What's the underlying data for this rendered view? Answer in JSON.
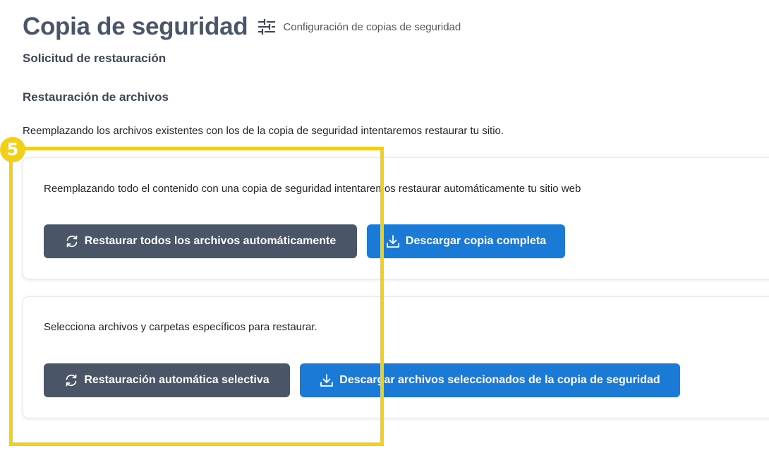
{
  "header": {
    "title": "Copia de seguridad",
    "settings_icon": "sliders-icon",
    "settings_label": "Configuración de copias de seguridad"
  },
  "subtitle": "Solicitud de restauración",
  "section": {
    "heading": "Restauración de archivos",
    "intro": "Reemplazando los archivos existentes con los de la copia de seguridad intentaremos restaurar tu sitio."
  },
  "cards": [
    {
      "description": "Reemplazando todo el contenido con una copia de seguridad intentaremos restaurar automáticamente tu sitio web",
      "primary_button": {
        "label": "Restaurar todos los archivos automáticamente",
        "icon": "refresh-icon"
      },
      "secondary_button": {
        "label": "Descargar copia completa",
        "icon": "download-icon"
      }
    },
    {
      "description": "Selecciona archivos y carpetas específicos para restaurar.",
      "primary_button": {
        "label": "Restauración automática selectiva",
        "icon": "refresh-icon"
      },
      "secondary_button": {
        "label": "Descargar archivos seleccionados de la copia de seguridad",
        "icon": "download-icon"
      }
    }
  ],
  "callout": {
    "number": "5",
    "color": "#f2cf1b"
  },
  "colors": {
    "dark_button": "#4a5567",
    "blue_button": "#1b7ad6",
    "title": "#4a5567"
  }
}
